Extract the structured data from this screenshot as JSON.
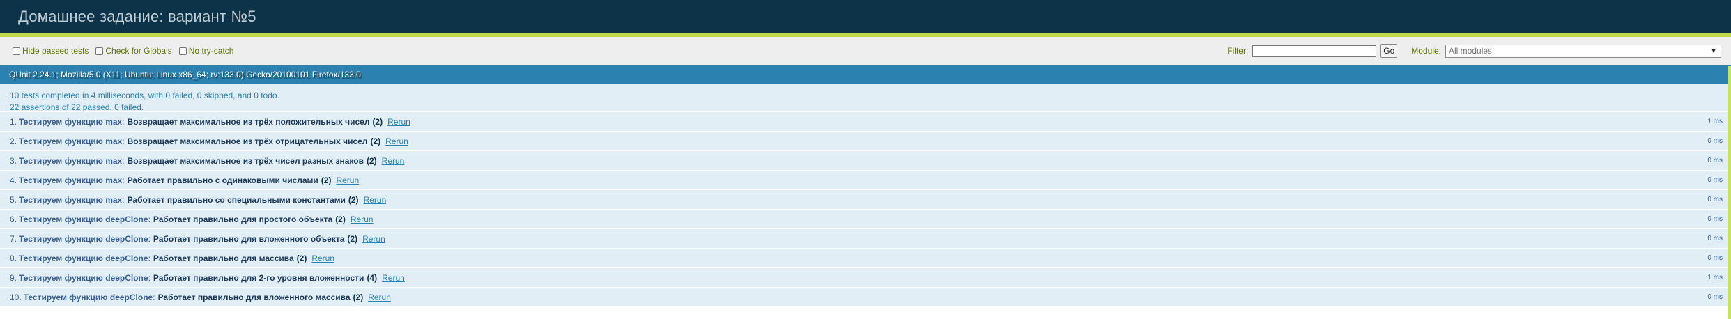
{
  "header": {
    "title": "Домашнее задание: вариант №5"
  },
  "toolbar": {
    "checks": [
      {
        "label": "Hide passed tests",
        "checked": false
      },
      {
        "label": "Check for Globals",
        "checked": false
      },
      {
        "label": "No try-catch",
        "checked": false
      }
    ],
    "filter_label": "Filter:",
    "filter_value": "",
    "go_label": "Go",
    "module_label": "Module:",
    "module_selected": "All modules"
  },
  "useragent": "QUnit 2.24.1; Mozilla/5.0 (X11; Ubuntu; Linux x86_64; rv:133.0) Gecko/20100101 Firefox/133.0",
  "results": {
    "line1": "10 tests completed in 4 milliseconds, with 0 failed, 0 skipped, and 0 todo.",
    "line2": "22 assertions of 22 passed, 0 failed."
  },
  "tests": [
    {
      "num": "1.",
      "module": "Тестируем функцию max",
      "name": "Возвращает максимальное из трёх положительных чисел",
      "counts": "(2)",
      "rerun": "Rerun",
      "time": "1 ms"
    },
    {
      "num": "2.",
      "module": "Тестируем функцию max",
      "name": "Возвращает максимальное из трёх отрицательных чисел",
      "counts": "(2)",
      "rerun": "Rerun",
      "time": "0 ms"
    },
    {
      "num": "3.",
      "module": "Тестируем функцию max",
      "name": "Возвращает максимальное из трёх чисел разных знаков",
      "counts": "(2)",
      "rerun": "Rerun",
      "time": "0 ms"
    },
    {
      "num": "4.",
      "module": "Тестируем функцию max",
      "name": "Работает правильно с одинаковыми числами",
      "counts": "(2)",
      "rerun": "Rerun",
      "time": "0 ms"
    },
    {
      "num": "5.",
      "module": "Тестируем функцию max",
      "name": "Работает правильно со специальными константами",
      "counts": "(2)",
      "rerun": "Rerun",
      "time": "0 ms"
    },
    {
      "num": "6.",
      "module": "Тестируем функцию deepClone",
      "name": "Работает правильно для простого объекта",
      "counts": "(2)",
      "rerun": "Rerun",
      "time": "0 ms"
    },
    {
      "num": "7.",
      "module": "Тестируем функцию deepClone",
      "name": "Работает правильно для вложенного объекта",
      "counts": "(2)",
      "rerun": "Rerun",
      "time": "0 ms"
    },
    {
      "num": "8.",
      "module": "Тестируем функцию deepClone",
      "name": "Работает правильно для массива",
      "counts": "(2)",
      "rerun": "Rerun",
      "time": "0 ms"
    },
    {
      "num": "9.",
      "module": "Тестируем функцию deepClone",
      "name": "Работает правильно для 2-го уровня вложенности",
      "counts": "(4)",
      "rerun": "Rerun",
      "time": "1 ms"
    },
    {
      "num": "10.",
      "module": "Тестируем функцию deepClone",
      "name": "Работает правильно для вложенного массива",
      "counts": "(2)",
      "rerun": "Rerun",
      "time": "0 ms"
    }
  ],
  "colors": {
    "header_bg": "#0d3349",
    "header_border": "#c2d94a",
    "useragent_bg": "#2b81af",
    "pass_bg": "#e2eef6",
    "pass_strip": "#c6e746"
  }
}
